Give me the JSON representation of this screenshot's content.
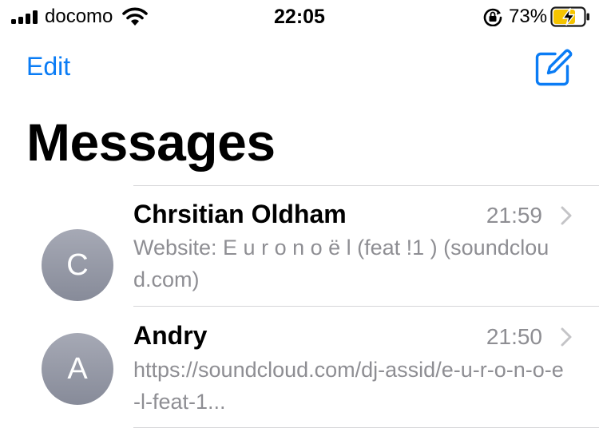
{
  "status_bar": {
    "carrier": "docomo",
    "time": "22:05",
    "battery_percent": "73%",
    "battery_level": 0.73,
    "charging": true,
    "icons": [
      "signal-icon",
      "wifi-icon",
      "orientation-lock-icon",
      "battery-charging-icon"
    ]
  },
  "nav": {
    "edit_label": "Edit",
    "compose_icon": "compose-icon"
  },
  "title": "Messages",
  "conversations": [
    {
      "initial": "C",
      "name": "Chrsitian Oldham",
      "time": "21:59",
      "preview": "Website: E u r o n o ë l (feat !1 ) (soundcloud.com)"
    },
    {
      "initial": "A",
      "name": "Andry",
      "time": "21:50",
      "preview": "https://soundcloud.com/dj-assid/e-u-r-o-n-o-e-l-feat-1..."
    }
  ],
  "colors": {
    "accent": "#0a7cf5",
    "secondary_text": "#8e8e93",
    "avatar": "#989ba8",
    "battery_charging": "#f5c400"
  }
}
